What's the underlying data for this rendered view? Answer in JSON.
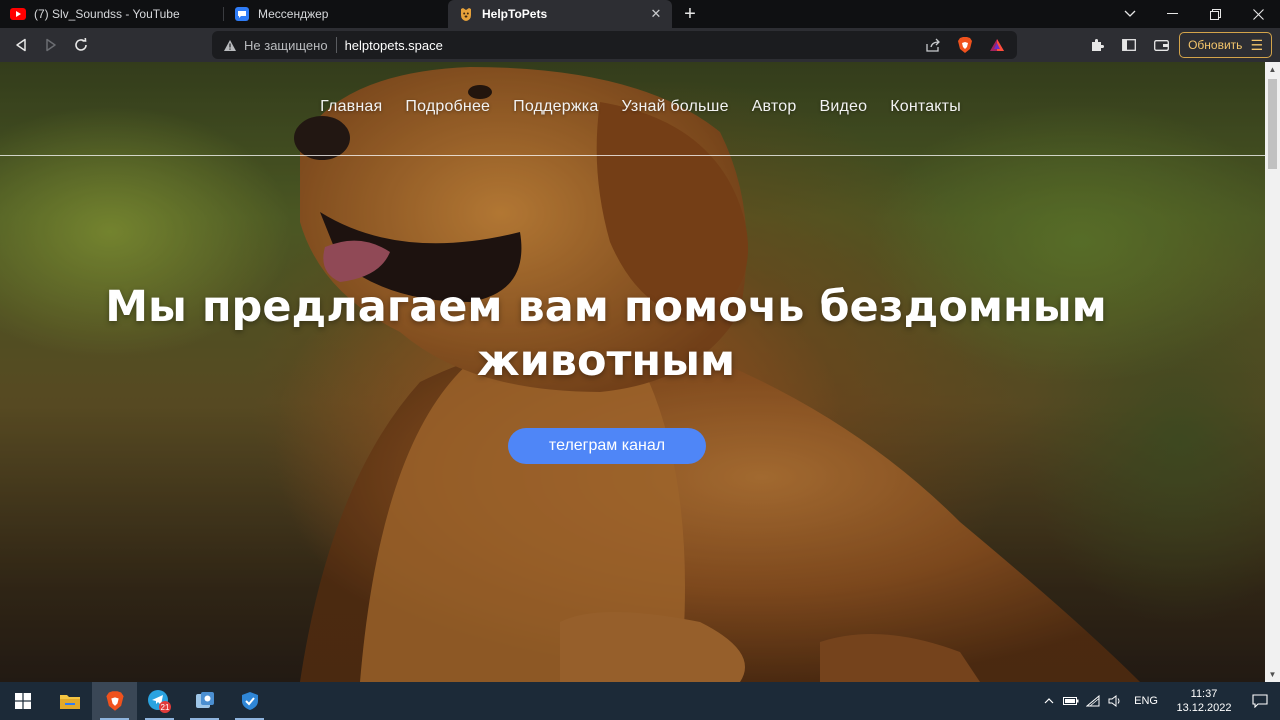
{
  "browser": {
    "tabs": [
      {
        "title": "(7) Slv_Soundss - YouTube",
        "icon": "youtube-icon",
        "active": false
      },
      {
        "title": "Мессенджер",
        "icon": "messenger-icon",
        "active": false
      },
      {
        "title": "HelpToPets",
        "icon": "site-favicon",
        "active": true
      }
    ],
    "new_tab_label": "+",
    "address": {
      "security_text": "Не защищено",
      "url": "helptopets.space"
    },
    "update_button": "Обновить"
  },
  "page": {
    "nav": [
      "Главная",
      "Подробнее",
      "Поддержка",
      "Узнай больше",
      "Автор",
      "Видео",
      "Контакты"
    ],
    "headline_line1": "Мы предлагаем вам помочь бездомным",
    "headline_line2": "животным",
    "cta_button": "телеграм канал",
    "accent_color": "#4f86f7"
  },
  "taskbar": {
    "apps": [
      "windows-start-icon",
      "file-explorer-icon",
      "brave-browser-icon",
      "telegram-icon",
      "vpn-app-icon",
      "defender-icon"
    ],
    "telegram_badge": "21",
    "language": "ENG",
    "time": "11:37",
    "date": "13.12.2022"
  }
}
